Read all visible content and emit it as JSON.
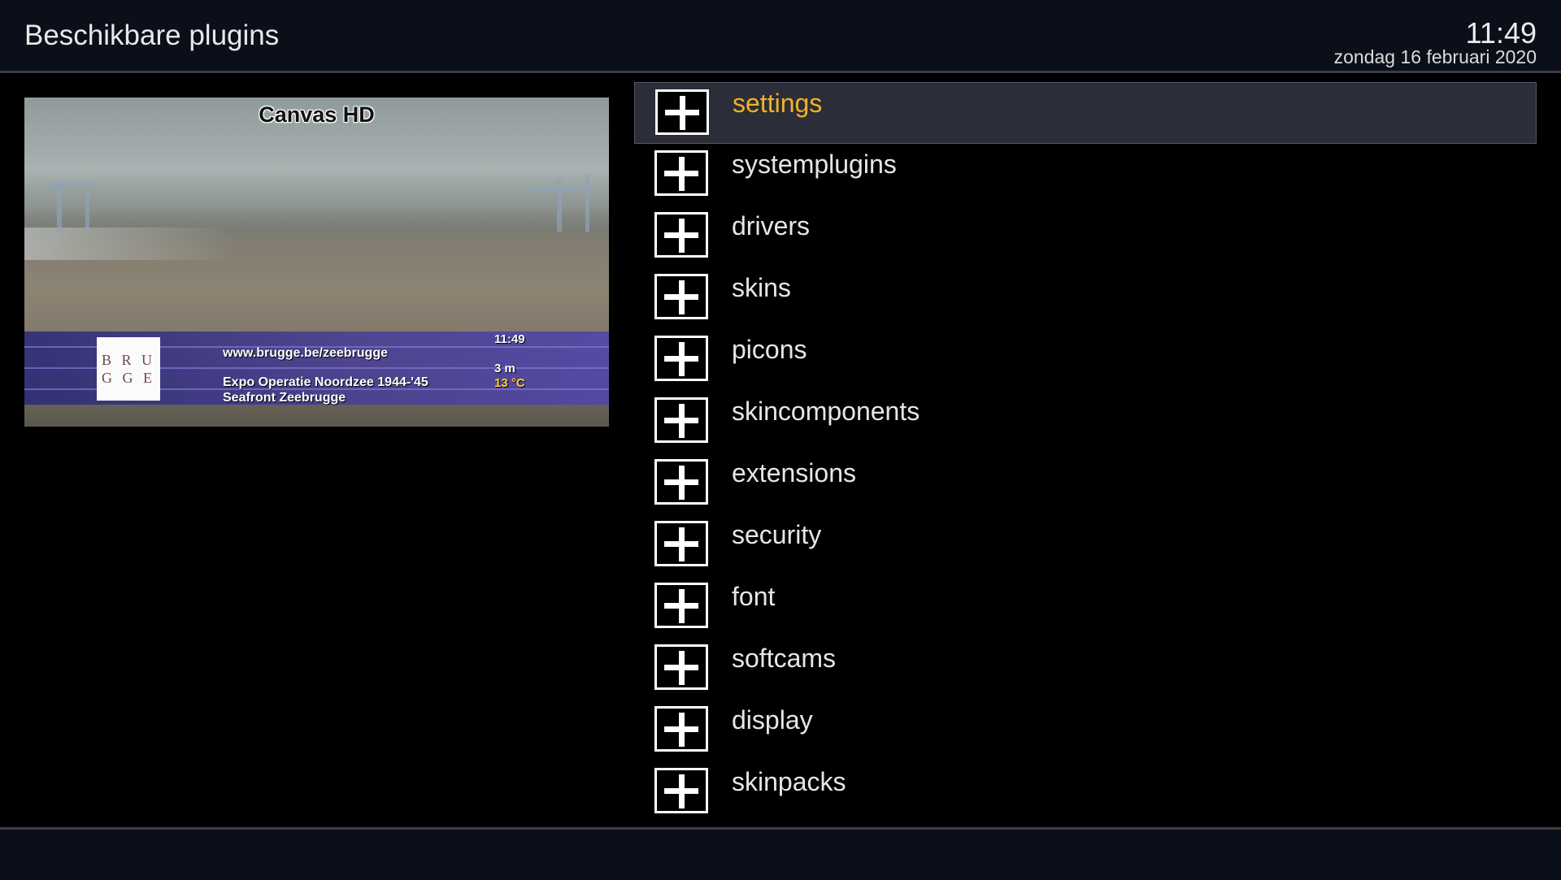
{
  "header": {
    "title": "Beschikbare plugins",
    "time": "11:49",
    "date": "zondag 16 februari 2020"
  },
  "preview": {
    "channel": "Canvas HD",
    "logo_line1": "B R U",
    "logo_line2": "G G E",
    "url": "www.brugge.be/zeebrugge",
    "time": "11:49",
    "line1": "Expo Operatie Noordzee 1944-'45",
    "line2": "Seafront Zeebrugge",
    "wind": "3 m",
    "temp": "13 °C"
  },
  "plugins": {
    "selected_index": 0,
    "items": [
      {
        "label": "settings"
      },
      {
        "label": "systemplugins"
      },
      {
        "label": "drivers"
      },
      {
        "label": "skins"
      },
      {
        "label": "picons"
      },
      {
        "label": "skincomponents"
      },
      {
        "label": "extensions"
      },
      {
        "label": "security"
      },
      {
        "label": "font"
      },
      {
        "label": "softcams"
      },
      {
        "label": "display"
      },
      {
        "label": "skinpacks"
      }
    ]
  },
  "colors": {
    "selected_text": "#f3b128",
    "selected_bg": "#2b2d38",
    "header_bg": "#0b0f19"
  },
  "icons": {
    "list_item": "plus-icon"
  }
}
